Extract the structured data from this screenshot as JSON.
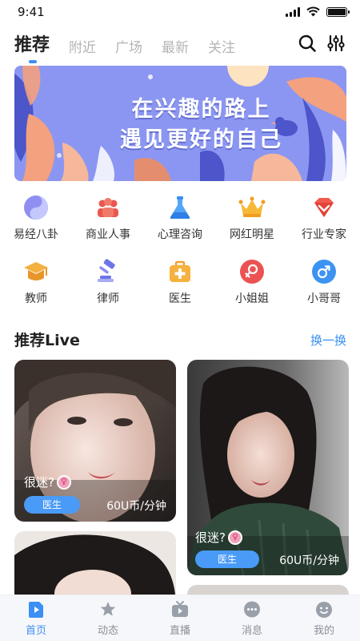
{
  "status_bar": {
    "time": "9:41"
  },
  "top_tabs": [
    {
      "label": "推荐",
      "active": true
    },
    {
      "label": "附近"
    },
    {
      "label": "广场"
    },
    {
      "label": "最新"
    },
    {
      "label": "关注"
    }
  ],
  "top_actions": {
    "search_icon": "search-icon",
    "filter_icon": "sliders-icon"
  },
  "banner": {
    "line1": "在兴趣的路上",
    "line2": "遇见更好的自己"
  },
  "categories": [
    {
      "label": "易经八卦",
      "icon": "yin-yang-icon"
    },
    {
      "label": "商业人事",
      "icon": "people-icon"
    },
    {
      "label": "心理咨询",
      "icon": "flask-icon"
    },
    {
      "label": "网红明星",
      "icon": "crown-icon"
    },
    {
      "label": "行业专家",
      "icon": "gem-icon"
    },
    {
      "label": "教师",
      "icon": "graduation-cap-icon"
    },
    {
      "label": "律师",
      "icon": "gavel-icon"
    },
    {
      "label": "医生",
      "icon": "medical-kit-icon"
    },
    {
      "label": "小姐姐",
      "icon": "female-icon"
    },
    {
      "label": "小哥哥",
      "icon": "male-icon"
    }
  ],
  "section": {
    "title": "推荐Live",
    "action": "换一换"
  },
  "live_cards": [
    {
      "caption": "很迷?",
      "tag": "医生",
      "price": "60U币/分钟"
    },
    {
      "caption": "很迷?",
      "tag": "医生",
      "price": "60U币/分钟"
    }
  ],
  "bottom_nav": [
    {
      "label": "首页",
      "icon": "home-play-icon",
      "active": true
    },
    {
      "label": "动态",
      "icon": "star-bubble-icon"
    },
    {
      "label": "直播",
      "icon": "tv-icon"
    },
    {
      "label": "消息",
      "icon": "chat-bubble-icon"
    },
    {
      "label": "我的",
      "icon": "face-icon"
    }
  ],
  "colors": {
    "accent": "#3b8ff5",
    "banner": "#8b96f2",
    "tag": "#4a9bf7"
  }
}
